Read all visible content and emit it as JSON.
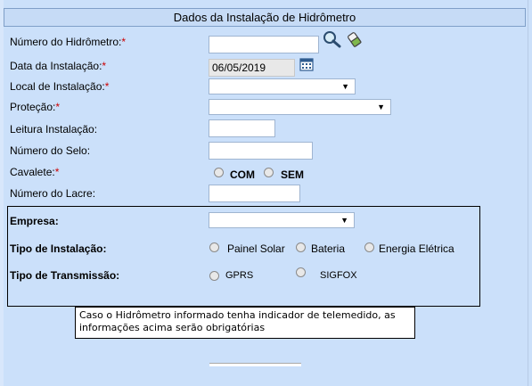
{
  "form": {
    "title": "Dados da Instalação de Hidrômetro",
    "fields": {
      "numero_hidrometro": {
        "label": "Número do Hidrômetro:",
        "required_mark": "*",
        "value": ""
      },
      "data_instalacao": {
        "label": "Data da Instalação:",
        "required_mark": "*",
        "value": "06/05/2019"
      },
      "local_instalacao": {
        "label": "Local de Instalação:",
        "required_mark": "*",
        "value": ""
      },
      "protecao": {
        "label": "Proteção:",
        "required_mark": "*",
        "value": ""
      },
      "leitura_instalacao": {
        "label": "Leitura Instalação:",
        "value": ""
      },
      "numero_selo": {
        "label": "Número do Selo:",
        "value": ""
      },
      "cavalete": {
        "label": "Cavalete:",
        "required_mark": "*",
        "options": [
          "COM",
          "SEM"
        ]
      },
      "numero_lacre": {
        "label": "Número do Lacre:",
        "value": ""
      }
    },
    "telemedido": {
      "empresa": {
        "label": "Empresa:",
        "value": ""
      },
      "tipo_instalacao": {
        "label": "Tipo de Instalação:",
        "options": [
          "Painel Solar",
          "Bateria",
          "Energia Elétrica"
        ]
      },
      "tipo_transmissao": {
        "label": "Tipo de Transmissão:",
        "options": [
          "GPRS",
          "SIGFOX"
        ]
      }
    },
    "note": "Caso o Hidrômetro informado tenha indicador de telemedido, as informações acima serão obrigatórias",
    "icons": [
      "search-icon",
      "eraser-icon",
      "calendar-icon"
    ]
  }
}
